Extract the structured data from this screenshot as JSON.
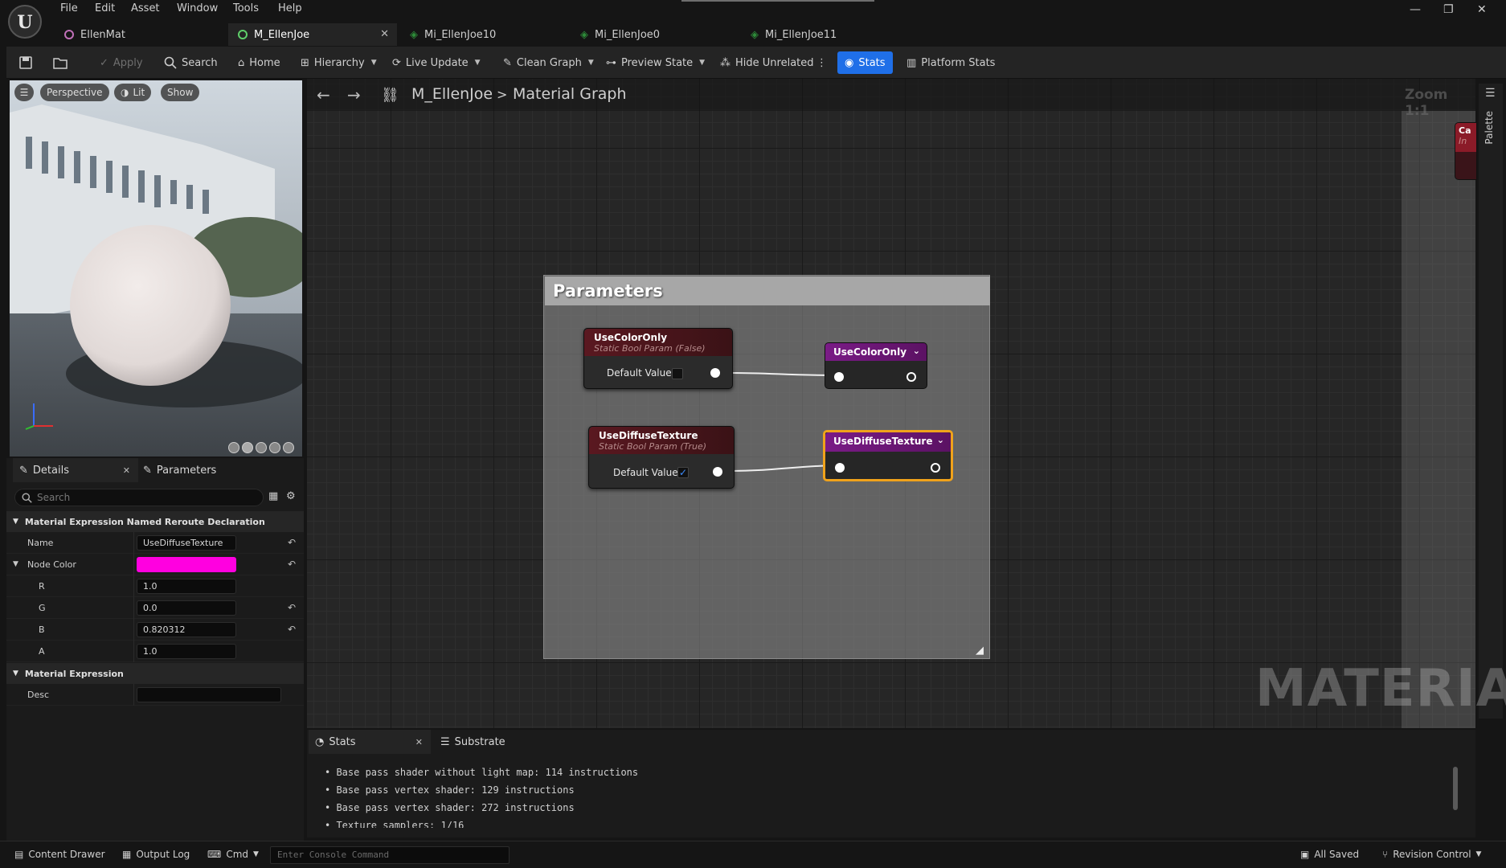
{
  "menu": [
    "File",
    "Edit",
    "Asset",
    "Window",
    "Tools",
    "Help"
  ],
  "doc_tabs": [
    {
      "label": "EllenMat"
    },
    {
      "label": "M_EllenJoe"
    },
    {
      "label": "Mi_EllenJoe10"
    },
    {
      "label": "Mi_EllenJoe0"
    },
    {
      "label": "Mi_EllenJoe11"
    }
  ],
  "toolbar": {
    "apply": "Apply",
    "search": "Search",
    "home": "Home",
    "hierarchy": "Hierarchy",
    "live_update": "Live Update",
    "clean_graph": "Clean Graph",
    "preview_state": "Preview State",
    "hide_unrelated": "Hide Unrelated",
    "stats": "Stats",
    "platform_stats": "Platform Stats"
  },
  "viewport": {
    "perspective": "Perspective",
    "lit": "Lit",
    "show": "Show"
  },
  "details": {
    "tab_details": "Details",
    "tab_parameters": "Parameters",
    "search_placeholder": "Search",
    "section1": "Material Expression Named Reroute Declaration",
    "name_label": "Name",
    "name_value": "UseDiffuseTexture",
    "node_color_label": "Node Color",
    "node_color": "#ff00e0",
    "channels": [
      {
        "label": "R",
        "value": "1.0"
      },
      {
        "label": "G",
        "value": "0.0"
      },
      {
        "label": "B",
        "value": "0.820312"
      },
      {
        "label": "A",
        "value": "1.0"
      }
    ],
    "section2": "Material Expression",
    "desc_label": "Desc",
    "desc_value": ""
  },
  "graph": {
    "breadcrumb_asset": "M_EllenJoe",
    "breadcrumb_graph": "Material Graph",
    "zoom": "Zoom 1:1",
    "palette": "Palette",
    "comment_title": "Parameters",
    "watermark": "MATERIAL",
    "nodes": [
      {
        "title": "UseColorOnly",
        "subtitle": "Static Bool Param (False)",
        "pin": "Default Value",
        "checked": false
      },
      {
        "title": "UseDiffuseTexture",
        "subtitle": "Static Bool Param (True)",
        "pin": "Default Value",
        "checked": true
      }
    ],
    "reroutes": [
      {
        "title": "UseColorOnly",
        "selected": false
      },
      {
        "title": "UseDiffuseTexture",
        "selected": true
      }
    ],
    "partial_node": {
      "line1": "Ca",
      "line2": "In"
    }
  },
  "stats_panel": {
    "tab_stats": "Stats",
    "tab_substrate": "Substrate",
    "lines": [
      "Base pass shader without light map: 114 instructions",
      "Base pass vertex shader: 129 instructions",
      "Base pass vertex shader: 272 instructions",
      "Texture samplers: 1/16"
    ]
  },
  "statusbar": {
    "content_drawer": "Content Drawer",
    "output_log": "Output Log",
    "cmd": "Cmd",
    "console_placeholder": "Enter Console Command",
    "all_saved": "All Saved",
    "revision_control": "Revision Control"
  }
}
